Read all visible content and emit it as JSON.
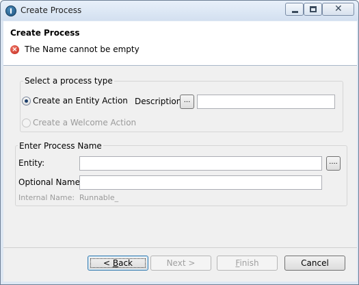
{
  "window": {
    "title": "Create Process"
  },
  "header": {
    "title": "Create Process",
    "error_message": "The Name cannot be empty"
  },
  "process_type_group": {
    "legend": "Select a process type",
    "option_entity_action": "Create an Entity Action",
    "option_welcome_action": "Create a Welcome Action",
    "description_label": "Description",
    "description_browse_label": "...",
    "description_value": ""
  },
  "process_name_group": {
    "legend": "Enter Process Name",
    "entity_label": "Entity:",
    "entity_value": "",
    "entity_browse_label": "....",
    "optional_name_label": "Optional Name:",
    "optional_name_value": "",
    "internal_name_label": "Internal Name:",
    "internal_name_value": "Runnable_"
  },
  "buttons": {
    "back_prefix": "< ",
    "back_mnemonic": "B",
    "back_rest": "ack",
    "next": "Next >",
    "finish_mnemonic": "F",
    "finish_rest": "inish",
    "cancel": "Cancel"
  },
  "colors": {
    "title_bar": "#d3e0f0",
    "error_icon": "#c02318",
    "default_button_border": "#3c7fb1"
  }
}
